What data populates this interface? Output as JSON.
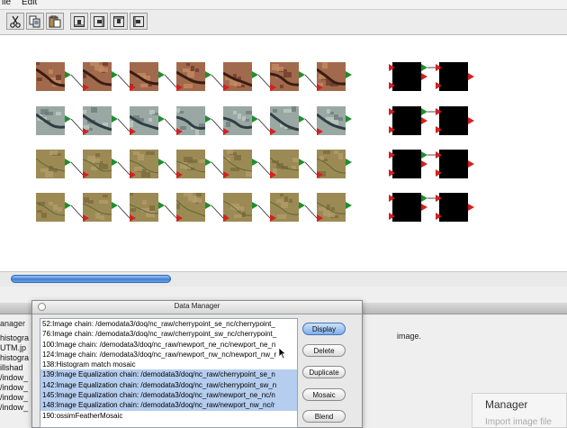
{
  "menubar": {
    "items": [
      "ile",
      "Edit"
    ]
  },
  "toolbar": {
    "buttons": [
      {
        "name": "cut-button",
        "icon": "scissors-icon"
      },
      {
        "name": "copy-button",
        "icon": "copy-icon"
      },
      {
        "name": "paste-button",
        "icon": "paste-icon"
      },
      {
        "name": "align-bottom-button",
        "icon": "align-bottom-icon"
      },
      {
        "name": "align-right-button",
        "icon": "align-right-icon"
      },
      {
        "name": "align-top-button",
        "icon": "align-top-icon"
      },
      {
        "name": "align-left-button",
        "icon": "align-left-icon"
      }
    ]
  },
  "canvas": {
    "image_row_styles": [
      "dark-red-delta",
      "grey-blue-delta",
      "olive-green",
      "olive-green"
    ],
    "images_per_row": 7,
    "mosaic_nodes_per_row": 2
  },
  "background_window": {
    "label": "anager",
    "list_items": [
      "histogra",
      "UTM.jp",
      "histogra",
      "illshad",
      "/indow_",
      "/indow_",
      "/indow_",
      "/indow_"
    ],
    "image_text": "image.",
    "manager_title": "Manager",
    "manager_subtitle": "Import image file"
  },
  "data_manager": {
    "title": "Data Manager",
    "rows": [
      {
        "text": "52:Image chain: /demodata3/doq/nc_raw/cherrypoint_se_nc/cherrypoint_",
        "selected": false
      },
      {
        "text": "76:Image chain: /demodata3/doq/nc_raw/cherrypoint_sw_nc/cherrypoint_",
        "selected": false
      },
      {
        "text": "100:Image chain: /demodata3/doq/nc_raw/newport_ne_nc/newport_ne_n",
        "selected": false
      },
      {
        "text": "124:Image chain: /demodata3/doq/nc_raw/newport_nw_nc/newport_nw_r",
        "selected": false
      },
      {
        "text": "138:Histogram match mosaic",
        "selected": false
      },
      {
        "text": "139:Image Equalization chain: /demodata3/doq/nc_raw/cherrypoint_se_n",
        "selected": true
      },
      {
        "text": "142:Image Equalization chain: /demodata3/doq/nc_raw/cherrypoint_sw_n",
        "selected": true
      },
      {
        "text": "145:Image Equalization chain: /demodata3/doq/nc_raw/newport_ne_nc/n",
        "selected": true
      },
      {
        "text": "148:Image Equalization chain: /demodata3/doq/nc_raw/newport_nw_nc/r",
        "selected": true
      },
      {
        "text": "190:ossimFeatherMosaic",
        "selected": false
      }
    ],
    "buttons": {
      "display": "Display",
      "delete": "Delete",
      "duplicate": "Duplicate",
      "mosaic": "Mosaic",
      "blend": "Blend"
    }
  },
  "colors": {
    "port_input": "#d42020",
    "port_output": "#1e8f2e",
    "selection": "#b5cdee",
    "primary_button": "#7fb0ec"
  }
}
